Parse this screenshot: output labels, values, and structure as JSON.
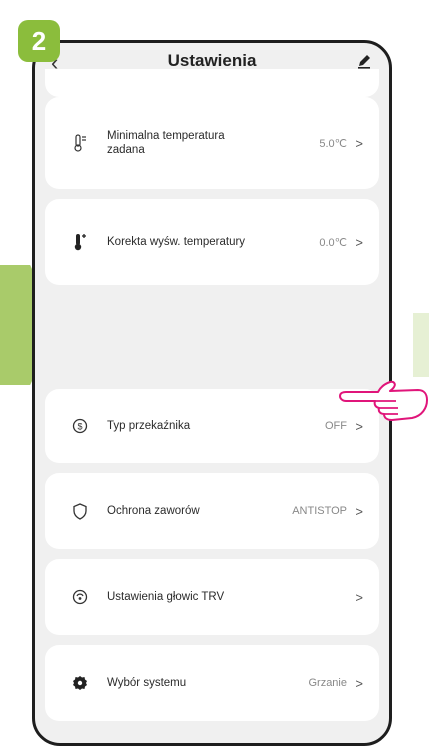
{
  "step_badge": "2",
  "header": {
    "title": "Ustawienia",
    "back_icon": "chevron-left-icon",
    "edit_icon": "pencil-icon"
  },
  "settings": [
    {
      "label": "Minimalna temperatura\nzadana",
      "value": "5.0℃",
      "icon": "thermometer-min-icon"
    },
    {
      "label": "Korekta wyśw. temperatury",
      "value": "0.0℃",
      "icon": "thermometer-plus-icon"
    },
    {
      "label": "Typ przekaźnika",
      "value": "OFF",
      "icon": "relay-icon"
    },
    {
      "label": "Ochrona zaworów",
      "value": "ANTISTOP",
      "icon": "shield-icon"
    },
    {
      "label": "Ustawienia głowic TRV",
      "value": "",
      "icon": "trv-head-icon"
    },
    {
      "label": "Wybór systemu",
      "value": "Grzanie",
      "icon": "gear-icon"
    }
  ],
  "chevron": ">",
  "colors": {
    "badge": "#8bbd3c",
    "arrow": "#a9cb6a",
    "hand": "#e0157a"
  }
}
